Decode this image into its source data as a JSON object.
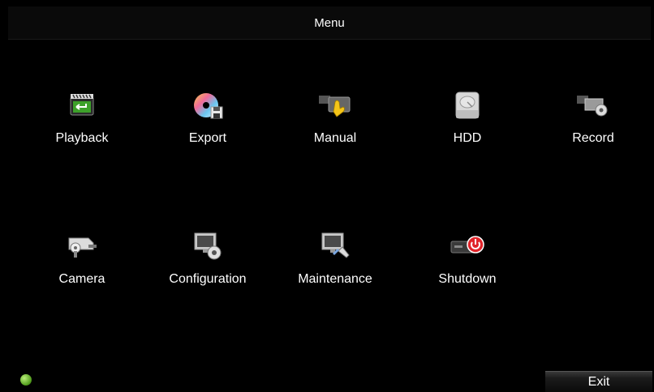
{
  "window": {
    "title": "Menu"
  },
  "menu": {
    "items": [
      {
        "label": "Playback",
        "icon": "playback-icon"
      },
      {
        "label": "Export",
        "icon": "export-icon"
      },
      {
        "label": "Manual",
        "icon": "manual-record-icon"
      },
      {
        "label": "HDD",
        "icon": "hdd-icon"
      },
      {
        "label": "Record",
        "icon": "record-settings-icon"
      },
      {
        "label": "Camera",
        "icon": "camera-settings-icon"
      },
      {
        "label": "Configuration",
        "icon": "configuration-icon"
      },
      {
        "label": "Maintenance",
        "icon": "maintenance-icon"
      },
      {
        "label": "Shutdown",
        "icon": "shutdown-icon"
      }
    ]
  },
  "footer": {
    "status_icon": "status-indicator-icon",
    "status_color": "#6cc030",
    "exit_label": "Exit"
  }
}
